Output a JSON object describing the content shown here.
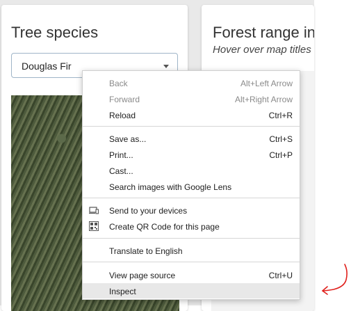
{
  "left_panel": {
    "title": "Tree species",
    "select_value": "Douglas Fir"
  },
  "right_panel": {
    "title": "Forest range in",
    "subtitle": "Hover over map titles"
  },
  "context_menu": {
    "items": [
      {
        "label": "Back",
        "shortcut": "Alt+Left Arrow",
        "disabled": true
      },
      {
        "label": "Forward",
        "shortcut": "Alt+Right Arrow",
        "disabled": true
      },
      {
        "label": "Reload",
        "shortcut": "Ctrl+R"
      },
      {
        "label": "Save as...",
        "shortcut": "Ctrl+S"
      },
      {
        "label": "Print...",
        "shortcut": "Ctrl+P"
      },
      {
        "label": "Cast..."
      },
      {
        "label": "Search images with Google Lens"
      },
      {
        "label": "Send to your devices",
        "icon": "devices-icon"
      },
      {
        "label": "Create QR Code for this page",
        "icon": "qr-code-icon"
      },
      {
        "label": "Translate to English"
      },
      {
        "label": "View page source",
        "shortcut": "Ctrl+U"
      },
      {
        "label": "Inspect",
        "highlighted": true
      }
    ]
  },
  "annotation": {
    "color": "#e0201c",
    "icon": "hand-drawn-arrow-icon"
  }
}
